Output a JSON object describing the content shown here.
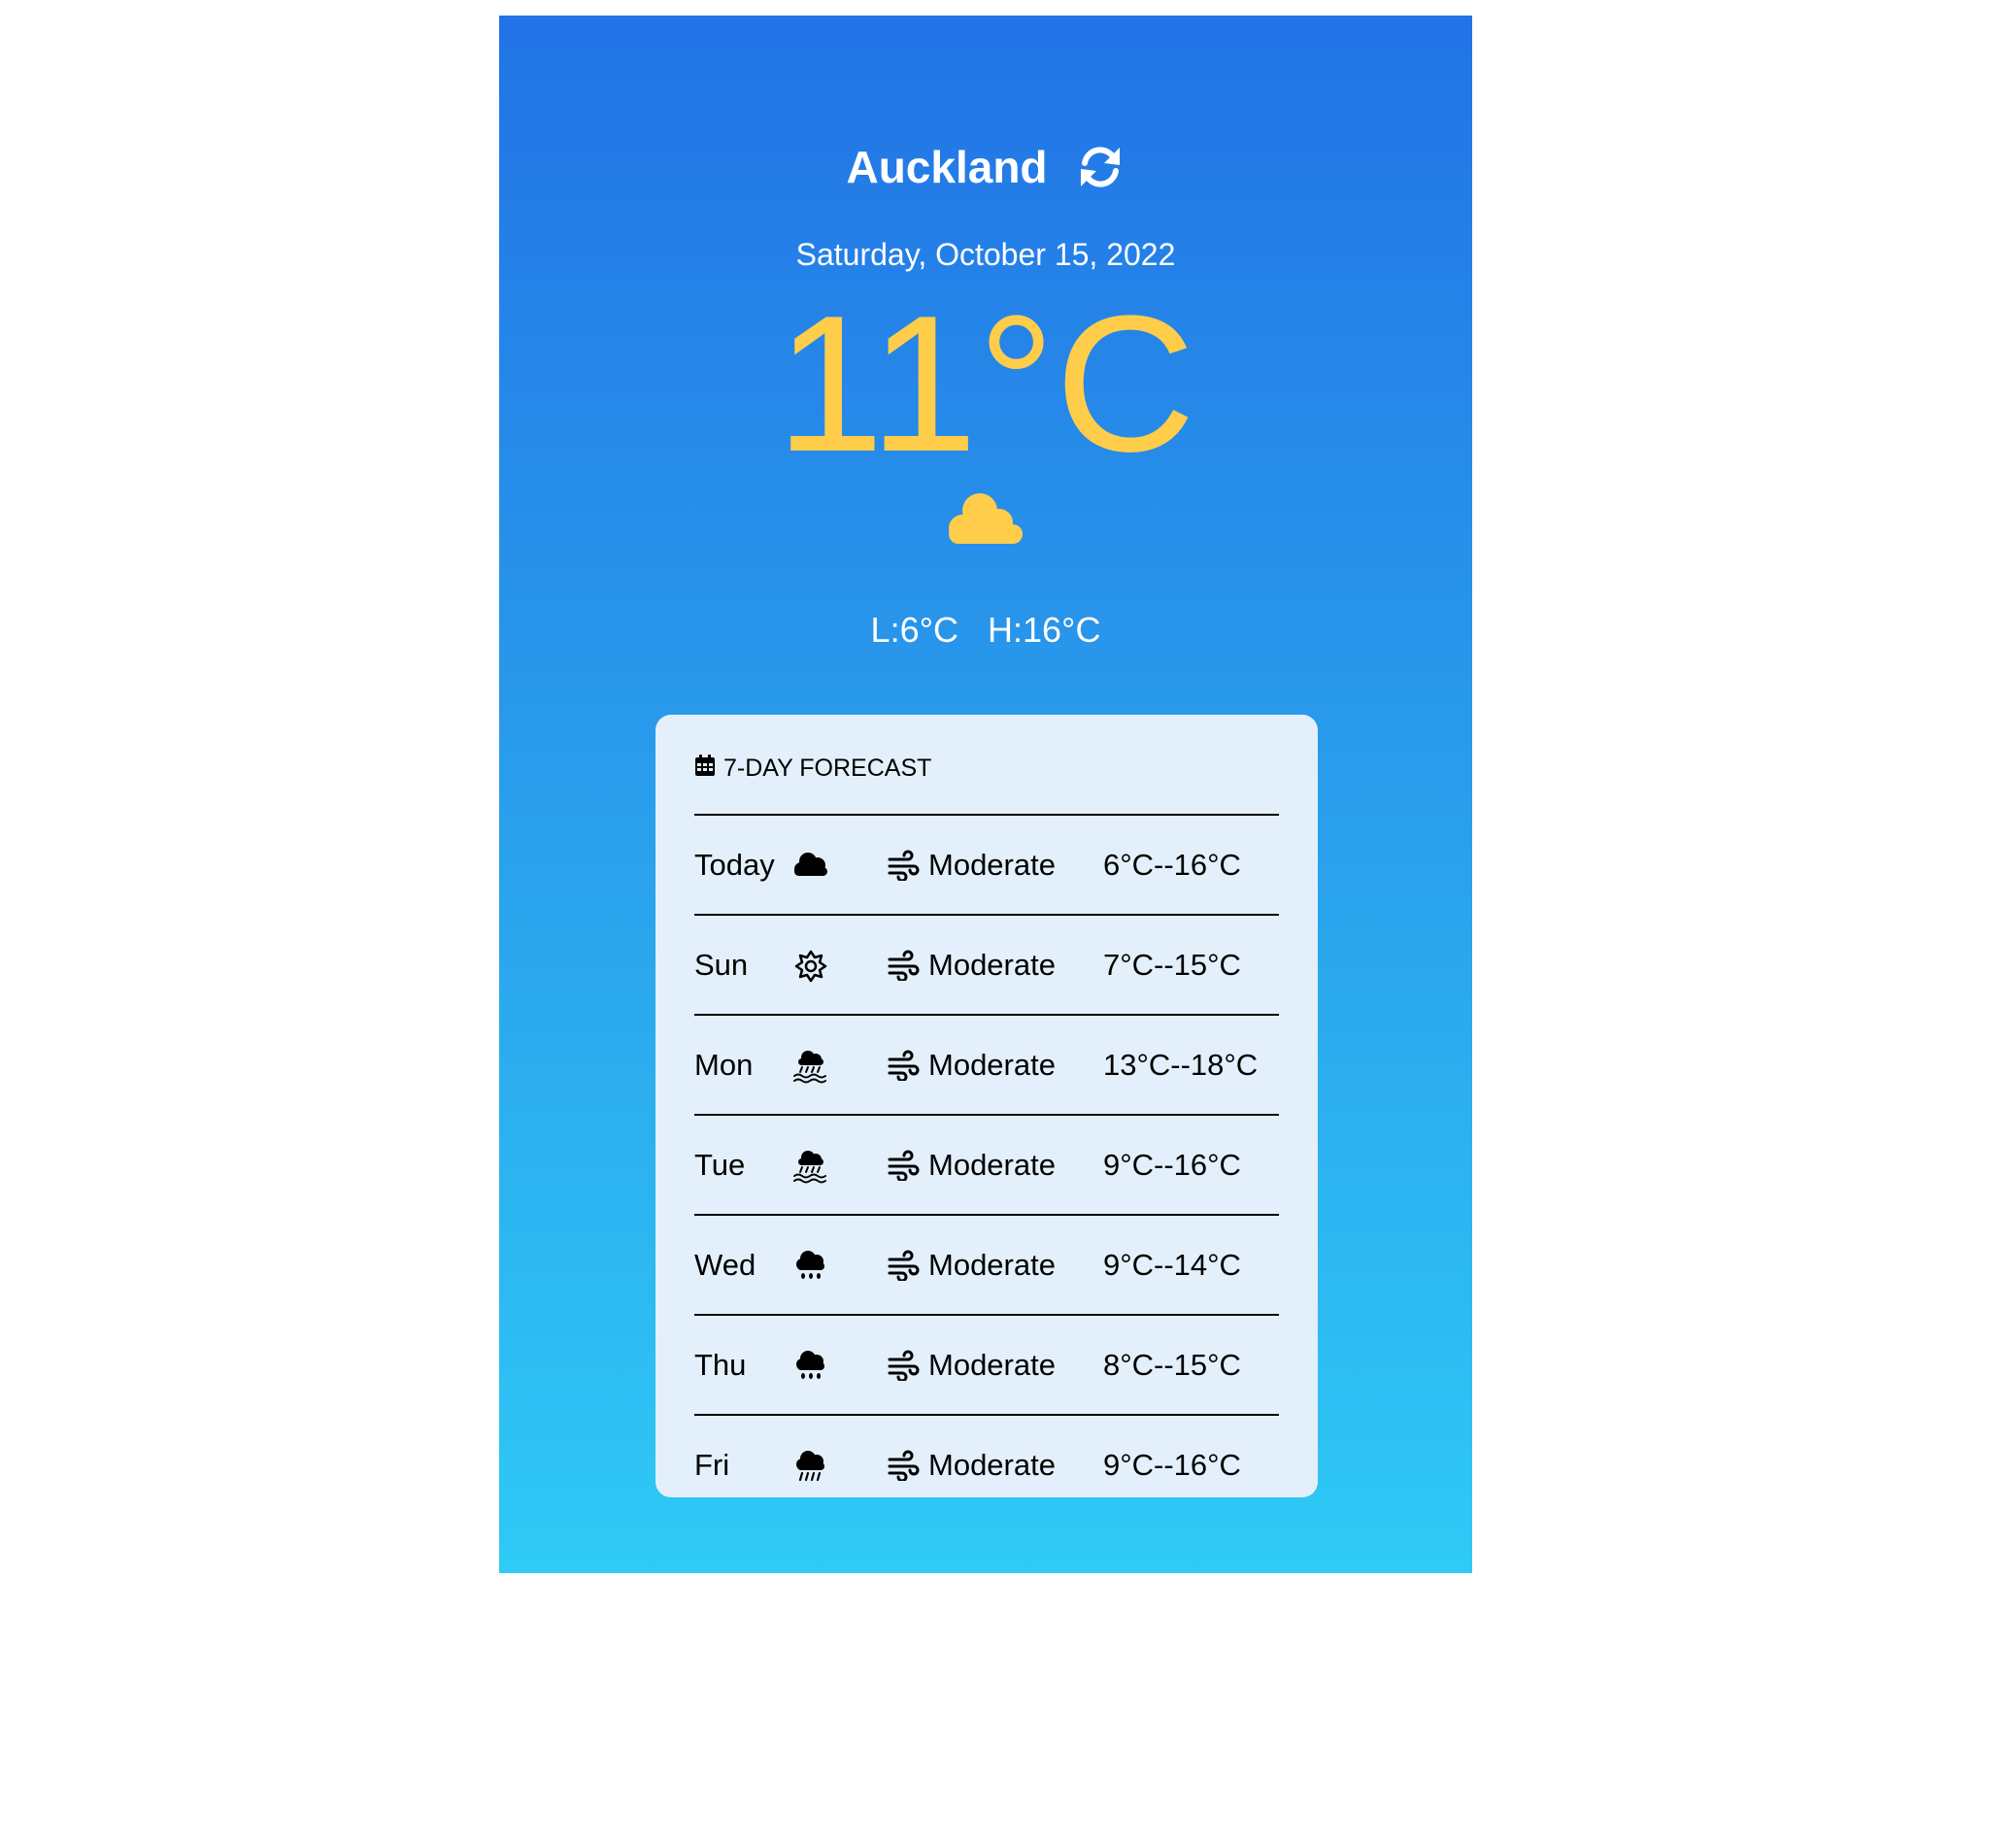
{
  "header": {
    "city": "Auckland",
    "refresh_icon": "refresh-icon"
  },
  "current": {
    "date": "Saturday, October 15, 2022",
    "temperature": "11°C",
    "condition_icon": "cloud-icon",
    "low": "L:6°C",
    "high": "H:16°C"
  },
  "forecast": {
    "title": "7-DAY FORECAST",
    "title_icon": "calendar-icon",
    "days": [
      {
        "day": "Today",
        "icon": "cloud-icon",
        "wind": "Moderate",
        "range": "6°C--16°C"
      },
      {
        "day": "Sun",
        "icon": "sun-icon",
        "wind": "Moderate",
        "range": "7°C--15°C"
      },
      {
        "day": "Mon",
        "icon": "cloud-rain-wave-icon",
        "wind": "Moderate",
        "range": "13°C--18°C"
      },
      {
        "day": "Tue",
        "icon": "cloud-rain-wave-icon",
        "wind": "Moderate",
        "range": "9°C--16°C"
      },
      {
        "day": "Wed",
        "icon": "cloud-drizzle-icon",
        "wind": "Moderate",
        "range": "9°C--14°C"
      },
      {
        "day": "Thu",
        "icon": "cloud-drizzle-icon",
        "wind": "Moderate",
        "range": "8°C--15°C"
      },
      {
        "day": "Fri",
        "icon": "cloud-rain-icon",
        "wind": "Moderate",
        "range": "9°C--16°C"
      }
    ]
  },
  "colors": {
    "gradient_top": "#2273e6",
    "gradient_bottom": "#2fcaf6",
    "accent": "#ffcd4a",
    "card": "#e3f0fb"
  }
}
